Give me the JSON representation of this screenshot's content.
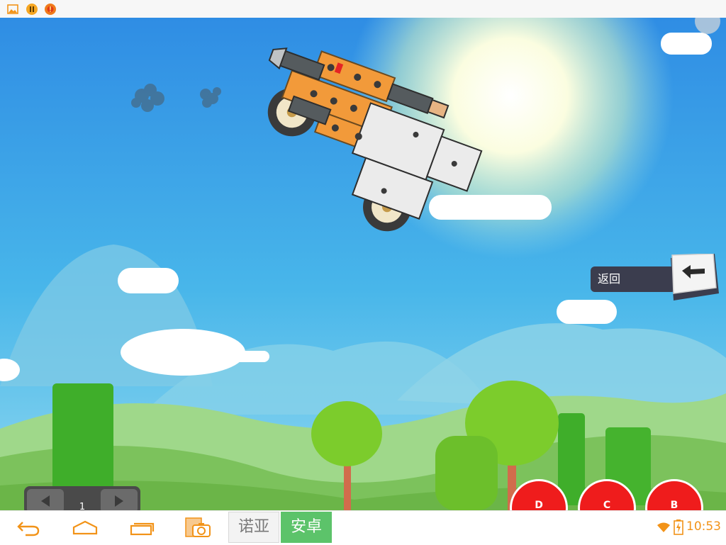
{
  "app": {
    "status_icons": [
      "picture-icon",
      "pause-badge-icon",
      "alert-badge-icon"
    ]
  },
  "game": {
    "back_label": "返回",
    "back_key_icon": "left-arrow-icon",
    "gear_value": "1",
    "buttons": [
      {
        "label": "D"
      },
      {
        "label": "C"
      },
      {
        "label": "B"
      }
    ]
  },
  "navbar": {
    "icons": [
      "back-icon",
      "home-icon",
      "recents-icon",
      "screenshot-icon"
    ],
    "ime": {
      "nokia": "诺亚",
      "android": "安卓"
    },
    "time": "10:53",
    "accent": "#f29318"
  }
}
